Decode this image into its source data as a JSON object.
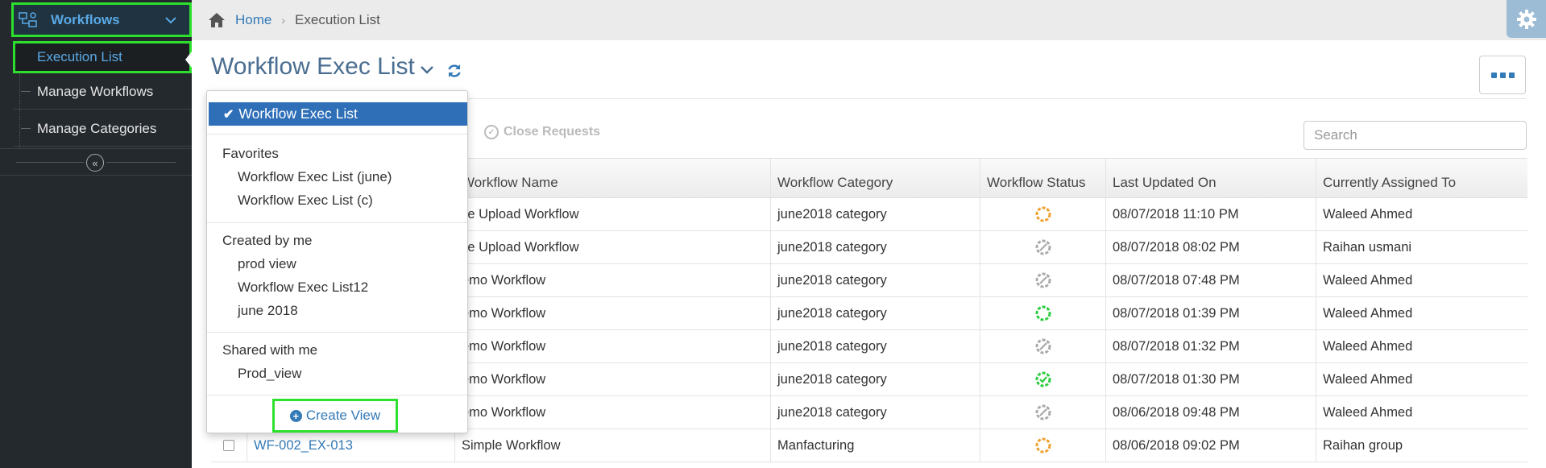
{
  "sidebar": {
    "header": {
      "label": "Workflows",
      "icon": "workflow-icon"
    },
    "items": [
      {
        "label": "Execution List",
        "active": true
      },
      {
        "label": "Manage Workflows",
        "active": false
      },
      {
        "label": "Manage Categories",
        "active": false
      }
    ],
    "collapse_icon": "double-chevron-left-icon"
  },
  "breadcrumb": {
    "home": "Home",
    "current": "Execution List"
  },
  "page": {
    "title": "Workflow Exec List"
  },
  "toolbar": {
    "close_requests": "Close Requests"
  },
  "search": {
    "placeholder": "Search"
  },
  "table": {
    "columns": [
      "Workflow Name",
      "Workflow Category",
      "Workflow Status",
      "Last Updated On",
      "Currently Assigned To"
    ],
    "rows": [
      {
        "id": "",
        "name": "ile Upload Workflow",
        "category": "june2018 category",
        "status": "in-progress",
        "updated": "08/07/2018 11:10 PM",
        "assigned": "Waleed Ahmed"
      },
      {
        "id": "",
        "name": "ile Upload Workflow",
        "category": "june2018 category",
        "status": "cancelled",
        "updated": "08/07/2018 08:02 PM",
        "assigned": "Raihan usmani"
      },
      {
        "id": "",
        "name": "emo Workflow",
        "category": "june2018 category",
        "status": "cancelled",
        "updated": "08/07/2018 07:48 PM",
        "assigned": "Waleed Ahmed"
      },
      {
        "id": "",
        "name": "emo Workflow",
        "category": "june2018 category",
        "status": "active",
        "updated": "08/07/2018 01:39 PM",
        "assigned": "Waleed Ahmed"
      },
      {
        "id": "",
        "name": "emo Workflow",
        "category": "june2018 category",
        "status": "cancelled",
        "updated": "08/07/2018 01:32 PM",
        "assigned": "Waleed Ahmed"
      },
      {
        "id": "",
        "name": "emo Workflow",
        "category": "june2018 category",
        "status": "completed",
        "updated": "08/07/2018 01:30 PM",
        "assigned": "Waleed Ahmed"
      },
      {
        "id": "",
        "name": "emo Workflow",
        "category": "june2018 category",
        "status": "cancelled",
        "updated": "08/06/2018 09:48 PM",
        "assigned": "Waleed Ahmed"
      },
      {
        "id": "WF-002_EX-013",
        "name": "Simple Workflow",
        "category": "Manfacturing",
        "status": "in-progress",
        "updated": "08/06/2018 09:02 PM",
        "assigned": "Raihan group"
      }
    ]
  },
  "dropdown": {
    "selected": "Workflow Exec List",
    "groups": [
      {
        "title": "Favorites",
        "items": [
          "Workflow Exec List (june)",
          "Workflow Exec List (c)"
        ]
      },
      {
        "title": "Created by me",
        "items": [
          "prod view",
          "Workflow Exec List12",
          "june 2018"
        ]
      },
      {
        "title": "Shared with me",
        "items": [
          "Prod_view"
        ]
      }
    ],
    "create_label": "Create View"
  },
  "colors": {
    "sidebar_bg": "#24292d",
    "accent": "#337ab7",
    "highlight": "#2de02d",
    "status_in_progress": "#f0a030",
    "status_cancelled": "#aaaaaa",
    "status_active": "#2ecc40",
    "status_completed": "#2ecc40"
  }
}
